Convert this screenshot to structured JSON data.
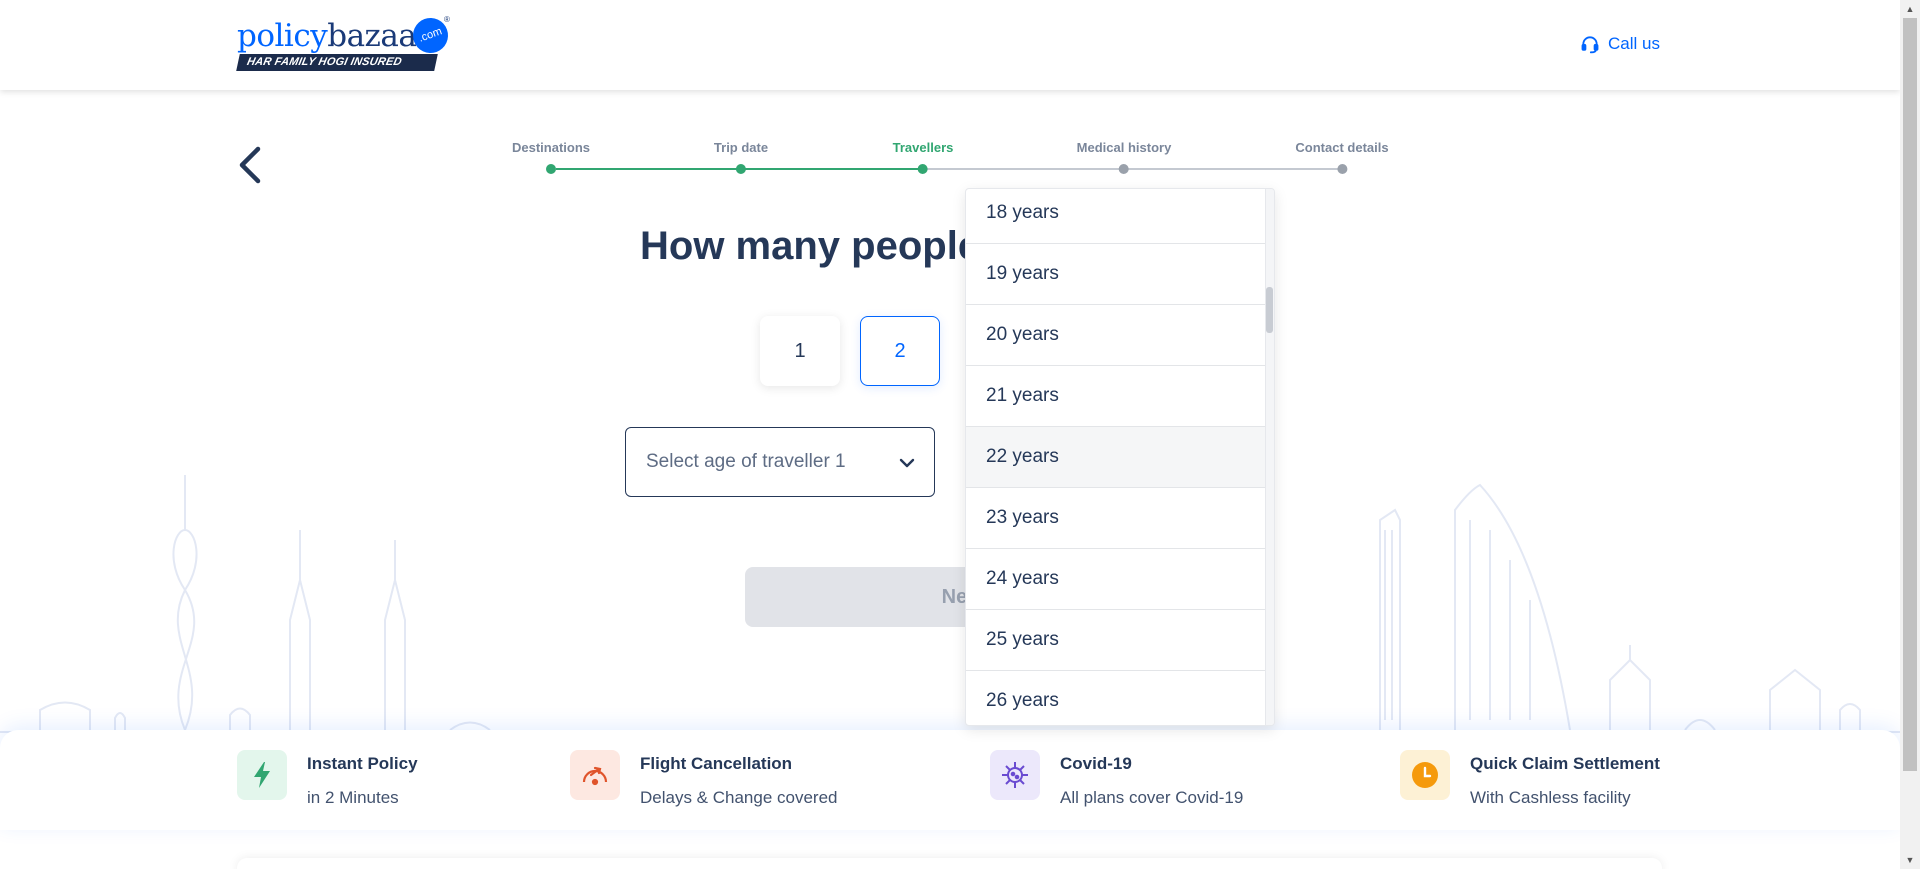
{
  "header": {
    "logo": {
      "part1": "policy",
      "part2": "bazaar",
      "dot": ".com",
      "tagline": "HAR FAMILY HOGI INSURED",
      "reg": "®"
    },
    "call_label": "Call us"
  },
  "stepper": {
    "steps": [
      {
        "label": "Destinations",
        "state": "done"
      },
      {
        "label": "Trip date",
        "state": "done"
      },
      {
        "label": "Travellers",
        "state": "active"
      },
      {
        "label": "Medical history",
        "state": "pending"
      },
      {
        "label": "Contact details",
        "state": "pending"
      }
    ]
  },
  "main": {
    "question": "How many people",
    "count_options": [
      "1",
      "2"
    ],
    "selected_count": "2",
    "age_placeholder": "Select age of traveller 1",
    "next_label": "Nex"
  },
  "dropdown": {
    "options": [
      "18 years",
      "19 years",
      "20 years",
      "21 years",
      "22 years",
      "23 years",
      "24 years",
      "25 years",
      "26 years"
    ],
    "hovered": "22 years"
  },
  "features": [
    {
      "title": "Instant Policy",
      "subtitle": "in 2 Minutes",
      "icon": "lightning-icon",
      "color": "#31a671",
      "bg": "#e3f6ec"
    },
    {
      "title": "Flight Cancellation",
      "subtitle": "Delays & Change covered",
      "icon": "flight-cancel-icon",
      "color": "#e0542b",
      "bg": "#fde8e1"
    },
    {
      "title": "Covid-19",
      "subtitle": "All plans cover Covid-19",
      "icon": "virus-icon",
      "color": "#6a4bd1",
      "bg": "#ece8fb"
    },
    {
      "title": "Quick Claim Settlement",
      "subtitle": "With Cashless facility",
      "icon": "clock-icon",
      "color": "#f59a0c",
      "bg": "#fdf1d5"
    }
  ],
  "colors": {
    "brand": "#0065ff",
    "navy": "#253858",
    "success": "#31a671"
  }
}
